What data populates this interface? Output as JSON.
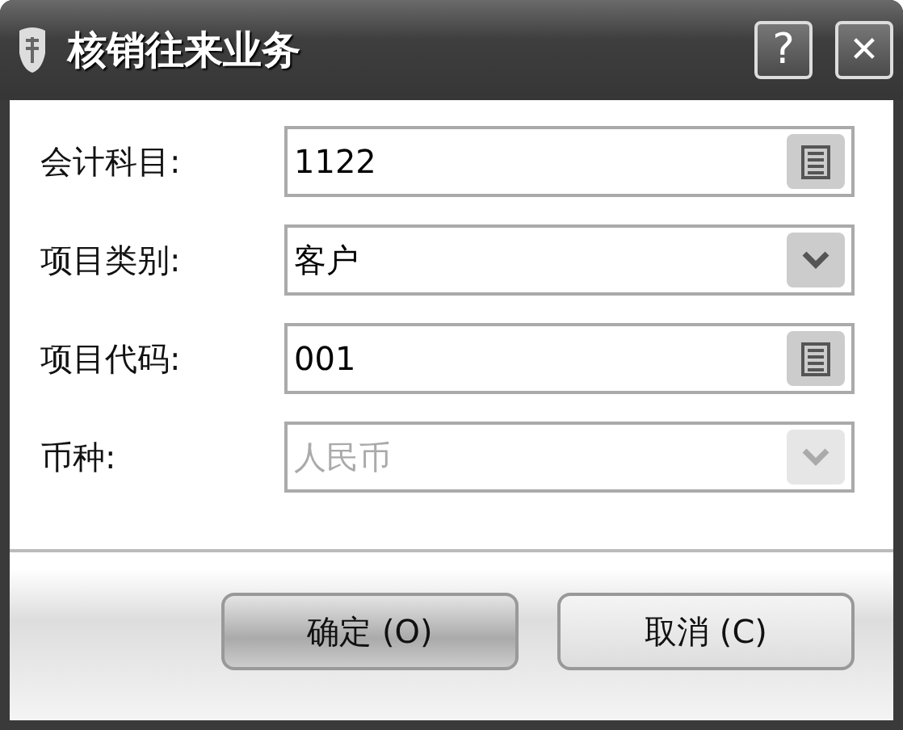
{
  "window": {
    "title": "核销往来业务",
    "buttons": [
      {
        "kind": "help",
        "label": "?"
      },
      {
        "kind": "close",
        "label": "✕"
      }
    ]
  },
  "fields": [
    {
      "label": "会计科目:",
      "kind": "lookup",
      "value": "1122",
      "disabled": false
    },
    {
      "label": "项目类别:",
      "kind": "dropdown",
      "value": "客户",
      "disabled": false
    },
    {
      "label": "项目代码:",
      "kind": "lookup",
      "value": "001",
      "disabled": false
    },
    {
      "label": "币种:",
      "kind": "dropdown",
      "value": "人民币",
      "disabled": true
    }
  ],
  "buttons": [
    {
      "label": "确定 (O)",
      "default": true
    },
    {
      "label": "取消 (C)",
      "default": false
    }
  ]
}
